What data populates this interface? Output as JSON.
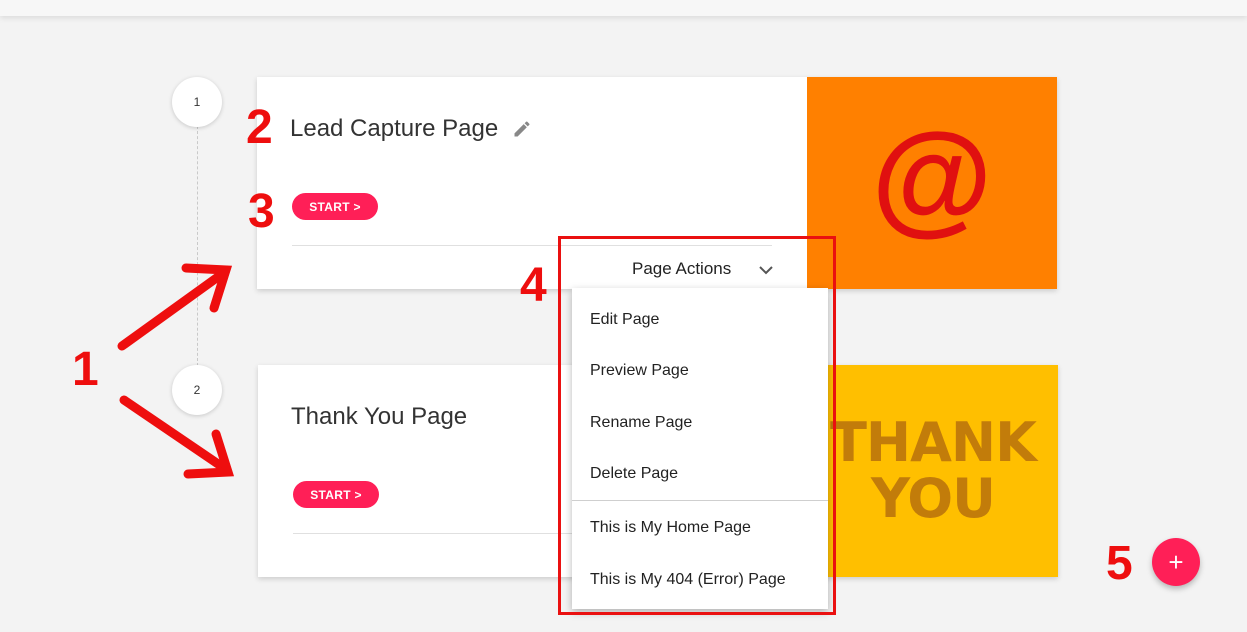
{
  "steps": [
    {
      "number": "1",
      "title": "Lead Capture Page",
      "start_label": "START >",
      "page_actions_label": "Page Actions",
      "thumbnail_text": "@"
    },
    {
      "number": "2",
      "title": "Thank You Page",
      "start_label": "START >",
      "thumbnail_line1": "THANK",
      "thumbnail_line2": "YOU"
    }
  ],
  "page_actions_menu": [
    "Edit Page",
    "Preview Page",
    "Rename Page",
    "Delete Page",
    "This is My Home Page",
    "This is My 404 (Error) Page"
  ],
  "fab_label": "+",
  "annotations": [
    "1",
    "2",
    "3",
    "4",
    "5"
  ],
  "colors": {
    "accent": "#ff1f57",
    "annotation_red": "#ee0e0e",
    "thumb_orange": "#ff8000",
    "thumb_yellow": "#ffbf00"
  },
  "icons": {
    "edit": "pencil-icon",
    "dropdown": "chevron-down-icon",
    "add": "plus-icon"
  }
}
